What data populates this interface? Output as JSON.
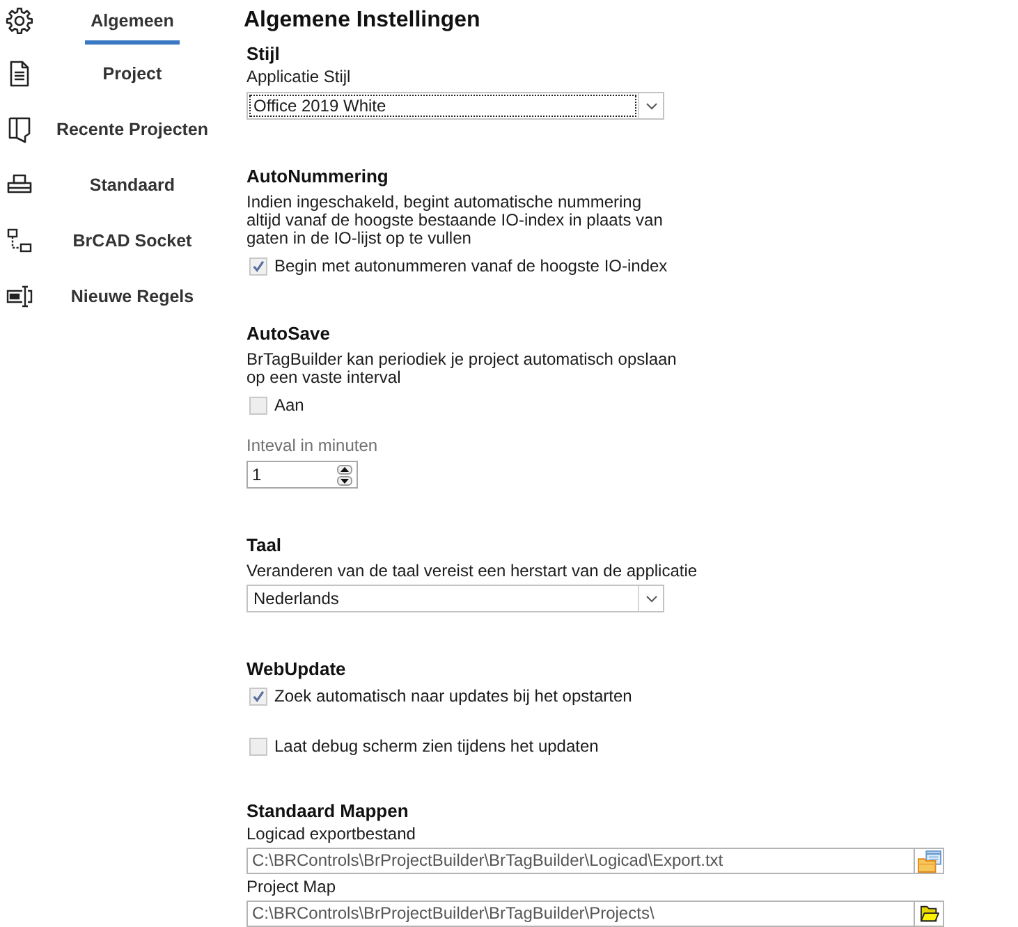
{
  "sidebar": {
    "items": [
      {
        "label": "Algemeen",
        "selected": true
      },
      {
        "label": "Project",
        "selected": false
      },
      {
        "label": "Recente Projecten",
        "selected": false
      },
      {
        "label": "Standaard",
        "selected": false
      },
      {
        "label": "BrCAD Socket",
        "selected": false
      },
      {
        "label": "Nieuwe Regels",
        "selected": false
      }
    ]
  },
  "title": "Algemene Instellingen",
  "sections": [
    {
      "heading": "Stijl",
      "items": [
        {
          "kind": "label",
          "text": "Applicatie Stijl",
          "disabled": false
        },
        {
          "kind": "combobox",
          "value": "Office 2019 White",
          "focused": true
        }
      ]
    },
    {
      "heading": "AutoNummering",
      "items": [
        {
          "kind": "description",
          "lines": [
            "Indien ingeschakeld, begint automatische nummering",
            "altijd vanaf de hoogste bestaande IO-index in plaats van",
            "gaten in de IO-lijst op te vullen"
          ]
        },
        {
          "kind": "checkbox",
          "label": "Begin met autonummeren vanaf de hoogste IO-index",
          "checked": true
        }
      ]
    },
    {
      "heading": "AutoSave",
      "items": [
        {
          "kind": "description",
          "lines": [
            "BrTagBuilder kan periodiek je project automatisch opslaan",
            "op een vaste interval"
          ]
        },
        {
          "kind": "checkbox",
          "label": "Aan",
          "checked": false
        },
        {
          "kind": "label",
          "text": "Inteval in minuten",
          "disabled": true
        },
        {
          "kind": "spinner",
          "value": "1"
        }
      ]
    },
    {
      "heading": "Taal",
      "items": [
        {
          "kind": "description",
          "lines": [
            "Veranderen van de taal vereist een herstart van de applicatie"
          ]
        },
        {
          "kind": "combobox",
          "value": "Nederlands",
          "focused": false
        }
      ]
    },
    {
      "heading": "WebUpdate",
      "items": [
        {
          "kind": "checkbox",
          "label": "Zoek automatisch naar updates bij het opstarten",
          "checked": true
        },
        {
          "kind": "checkbox",
          "label": "Laat debug scherm zien tijdens het updaten",
          "checked": false
        }
      ]
    },
    {
      "heading": "Standaard Mappen",
      "items": [
        {
          "kind": "label",
          "text": "Logicad exportbestand",
          "disabled": false
        },
        {
          "kind": "filepath",
          "value": "C:\\BRControls\\BrProjectBuilder\\BrTagBuilder\\Logicad\\Export.txt"
        },
        {
          "kind": "label",
          "text": "Project Map",
          "disabled": false
        },
        {
          "kind": "folderpath",
          "value": "C:\\BRControls\\BrProjectBuilder\\BrTagBuilder\\Projects\\"
        }
      ]
    }
  ]
}
